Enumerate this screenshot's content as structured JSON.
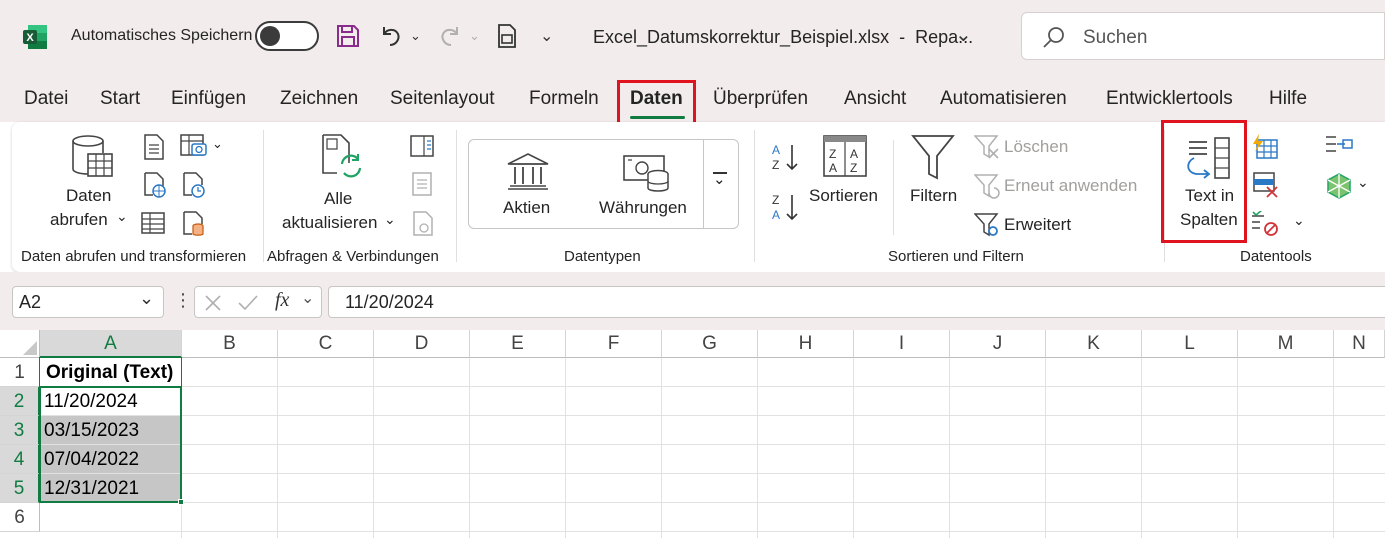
{
  "titlebar": {
    "autosave_label": "Automatisches Speichern",
    "filename": "Excel_Datumskorrektur_Beispiel.xlsx  -  Repa...",
    "search_placeholder": "Suchen"
  },
  "menu": [
    "Datei",
    "Start",
    "Einfügen",
    "Zeichnen",
    "Seitenlayout",
    "Formeln",
    "Daten",
    "Überprüfen",
    "Ansicht",
    "Automatisieren",
    "Entwicklertools",
    "Hilfe"
  ],
  "active_tab": "Daten",
  "ribbon": {
    "get_data": {
      "line1": "Daten",
      "line2": "abrufen"
    },
    "refresh_all": {
      "line1": "Alle",
      "line2": "aktualisieren"
    },
    "stocks": "Aktien",
    "currencies": "Währungen",
    "sort": "Sortieren",
    "filter": "Filtern",
    "clear": "Löschen",
    "reapply": "Erneut anwenden",
    "advanced": "Erweitert",
    "text_to_columns": {
      "line1": "Text in",
      "line2": "Spalten"
    },
    "groups": {
      "get_transform": "Daten abrufen und transformieren",
      "queries": "Abfragen & Verbindungen",
      "datatypes": "Datentypen",
      "sort_filter": "Sortieren und Filtern",
      "datatools": "Datentools"
    }
  },
  "formula_bar": {
    "namebox": "A2",
    "fx": "fx",
    "value": "11/20/2024"
  },
  "sheet": {
    "columns": [
      "A",
      "B",
      "C",
      "D",
      "E",
      "F",
      "G",
      "H",
      "I",
      "J",
      "K",
      "L",
      "M",
      "N"
    ],
    "rows": [
      "1",
      "2",
      "3",
      "4",
      "5",
      "6"
    ],
    "header_cell": "Original (Text)",
    "values": [
      "11/20/2024",
      "03/15/2023",
      "07/04/2022",
      "12/31/2021"
    ]
  },
  "colors": {
    "accent": "#107c41",
    "highlight": "#e0141e",
    "selection": "#c6c6c6"
  }
}
